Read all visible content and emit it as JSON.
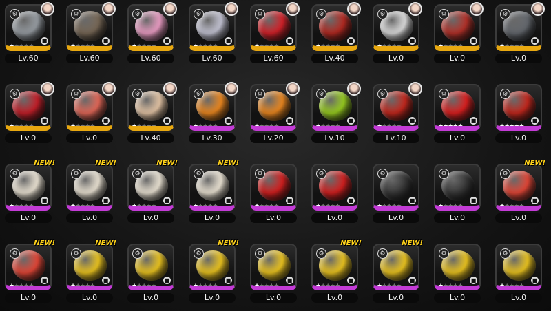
{
  "labels": {
    "new": "NEW!",
    "lock_icon": "lock-icon"
  },
  "colors": {
    "gold_rarity": "#e8a810",
    "purple_rarity": "#c33bd6",
    "new_badge": "#ffd21a"
  },
  "items": [
    {
      "level": "Lv.60",
      "rarity": "gold",
      "stars": 1,
      "avatar": true,
      "new": false,
      "art": "#9aa0a6"
    },
    {
      "level": "Lv.60",
      "rarity": "gold",
      "stars": 1,
      "avatar": true,
      "new": false,
      "art": "#7a6a58"
    },
    {
      "level": "Lv.60",
      "rarity": "gold",
      "stars": 1,
      "avatar": true,
      "new": false,
      "art": "#f0a0c8"
    },
    {
      "level": "Lv.60",
      "rarity": "gold",
      "stars": 1,
      "avatar": true,
      "new": false,
      "art": "#c8c8d8"
    },
    {
      "level": "Lv.60",
      "rarity": "gold",
      "stars": 1,
      "avatar": true,
      "new": false,
      "art": "#d8222a"
    },
    {
      "level": "Lv.40",
      "rarity": "gold",
      "stars": 1,
      "avatar": true,
      "new": false,
      "art": "#b82a22"
    },
    {
      "level": "Lv.0",
      "rarity": "gold",
      "stars": 1,
      "avatar": true,
      "new": false,
      "art": "#e0e0e0"
    },
    {
      "level": "Lv.0",
      "rarity": "gold",
      "stars": 1,
      "avatar": true,
      "new": false,
      "art": "#b8322a"
    },
    {
      "level": "Lv.0",
      "rarity": "gold",
      "stars": 1,
      "avatar": true,
      "new": false,
      "art": "#666a70"
    },
    {
      "level": "Lv.0",
      "rarity": "gold",
      "stars": 1,
      "avatar": true,
      "new": false,
      "art": "#c8202a"
    },
    {
      "level": "Lv.0",
      "rarity": "gold",
      "stars": 1,
      "avatar": true,
      "new": false,
      "art": "#e86a5a"
    },
    {
      "level": "Lv.40",
      "rarity": "gold",
      "stars": 1,
      "avatar": true,
      "new": false,
      "art": "#e8c8a8"
    },
    {
      "level": "Lv.30",
      "rarity": "purple",
      "stars": 1,
      "avatar": true,
      "new": false,
      "art": "#f08a20"
    },
    {
      "level": "Lv.20",
      "rarity": "purple",
      "stars": 1,
      "avatar": true,
      "new": false,
      "art": "#f08a20"
    },
    {
      "level": "Lv.10",
      "rarity": "purple",
      "stars": 1,
      "avatar": true,
      "new": false,
      "art": "#9ad020"
    },
    {
      "level": "Lv.10",
      "rarity": "purple",
      "stars": 1,
      "avatar": true,
      "new": false,
      "art": "#c8281e"
    },
    {
      "level": "Lv.0",
      "rarity": "purple",
      "stars": 5,
      "avatar": false,
      "new": false,
      "art": "#e02020"
    },
    {
      "level": "Lv.0",
      "rarity": "purple",
      "stars": 5,
      "avatar": false,
      "new": false,
      "art": "#c8281e"
    },
    {
      "level": "Lv.0",
      "rarity": "purple",
      "stars": 1,
      "avatar": false,
      "new": true,
      "art": "#f0e8d8"
    },
    {
      "level": "Lv.0",
      "rarity": "purple",
      "stars": 1,
      "avatar": false,
      "new": true,
      "art": "#f0e8d8"
    },
    {
      "level": "Lv.0",
      "rarity": "purple",
      "stars": 1,
      "avatar": false,
      "new": true,
      "art": "#f0e8d8"
    },
    {
      "level": "Lv.0",
      "rarity": "purple",
      "stars": 1,
      "avatar": false,
      "new": true,
      "art": "#f0e8d8"
    },
    {
      "level": "Lv.0",
      "rarity": "purple",
      "stars": 1,
      "avatar": false,
      "new": false,
      "art": "#d82020"
    },
    {
      "level": "Lv.0",
      "rarity": "purple",
      "stars": 1,
      "avatar": false,
      "new": false,
      "art": "#d82020"
    },
    {
      "level": "Lv.0",
      "rarity": "purple",
      "stars": 1,
      "avatar": false,
      "new": false,
      "art": "#3a3a3a"
    },
    {
      "level": "Lv.0",
      "rarity": "purple",
      "stars": 1,
      "avatar": false,
      "new": false,
      "art": "#3a3a3a"
    },
    {
      "level": "Lv.0",
      "rarity": "purple",
      "stars": 1,
      "avatar": false,
      "new": true,
      "art": "#e84838"
    },
    {
      "level": "Lv.0",
      "rarity": "purple",
      "stars": 1,
      "avatar": false,
      "new": true,
      "art": "#e84838"
    },
    {
      "level": "Lv.0",
      "rarity": "purple",
      "stars": 1,
      "avatar": false,
      "new": true,
      "art": "#f0c820"
    },
    {
      "level": "Lv.0",
      "rarity": "purple",
      "stars": 1,
      "avatar": false,
      "new": false,
      "art": "#f0c820"
    },
    {
      "level": "Lv.0",
      "rarity": "purple",
      "stars": 1,
      "avatar": false,
      "new": true,
      "art": "#f0c820"
    },
    {
      "level": "Lv.0",
      "rarity": "purple",
      "stars": 1,
      "avatar": false,
      "new": false,
      "art": "#f0c820"
    },
    {
      "level": "Lv.0",
      "rarity": "purple",
      "stars": 1,
      "avatar": false,
      "new": true,
      "art": "#f0c820"
    },
    {
      "level": "Lv.0",
      "rarity": "purple",
      "stars": 1,
      "avatar": false,
      "new": true,
      "art": "#f0c820"
    },
    {
      "level": "Lv.0",
      "rarity": "purple",
      "stars": 1,
      "avatar": false,
      "new": false,
      "art": "#f0c820"
    },
    {
      "level": "Lv.0",
      "rarity": "purple",
      "stars": 1,
      "avatar": false,
      "new": false,
      "art": "#f0c820"
    }
  ]
}
